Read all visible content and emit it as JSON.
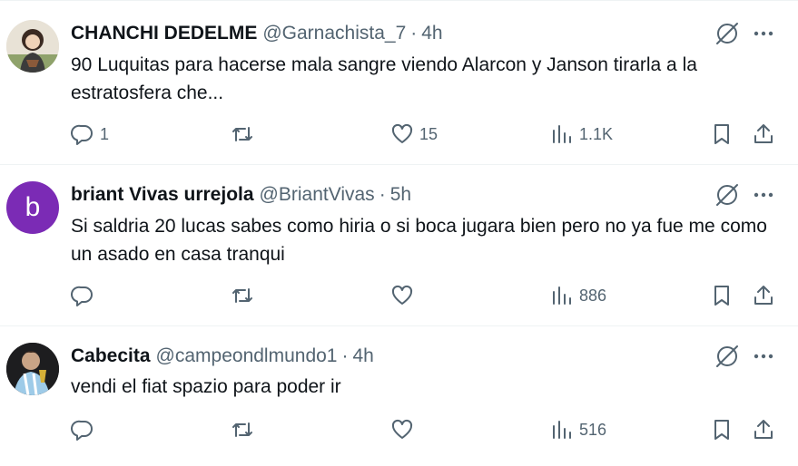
{
  "tweets": [
    {
      "name": "CHANCHI DEDELME",
      "handle": "@Garnachista_7",
      "dot": "·",
      "time": "4h",
      "text": "90 Luquitas para hacerse mala sangre viendo Alarcon y Janson tirarla a la estratosfera che...",
      "avatar_icon": "profile-photo",
      "replies": "1",
      "retweets": "",
      "likes": "15",
      "views": "1.1K"
    },
    {
      "name": "briant Vivas urrejola",
      "handle": "@BriantVivas",
      "dot": "·",
      "time": "5h",
      "text": "Si saldria 20 lucas sabes como hiria o si boca jugara bien pero no ya fue me como un asado en casa tranqui",
      "avatar_letter": "b",
      "avatar_color": "#7b2bb5",
      "replies": "",
      "retweets": "",
      "likes": "",
      "views": "886"
    },
    {
      "name": "Cabecita",
      "handle": "@campeondlmundo1",
      "dot": "·",
      "time": "4h",
      "text": "vendi el fiat spazio para poder ir",
      "avatar_icon": "profile-photo",
      "replies": "",
      "retweets": "",
      "likes": "",
      "views": "516"
    }
  ],
  "colors": {
    "text": "#0f1419",
    "muted": "#536471",
    "divider": "#eff3f4"
  }
}
